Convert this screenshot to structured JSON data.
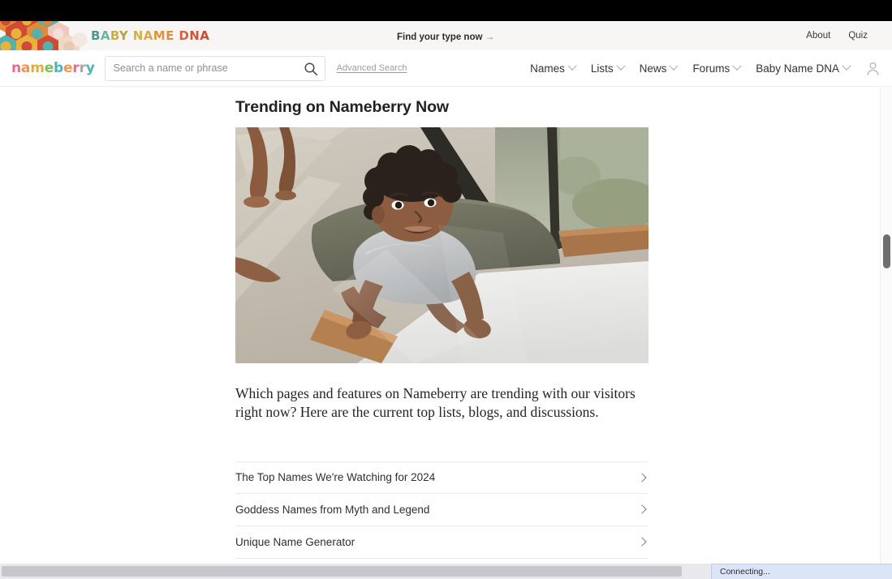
{
  "banner": {
    "title_parts": [
      {
        "text": "B",
        "color": "#4a9a8e"
      },
      {
        "text": "A",
        "color": "#6fb3a6"
      },
      {
        "text": "B",
        "color": "#cbb04a"
      },
      {
        "text": "Y",
        "color": "#b8a23f"
      },
      {
        "text": " ",
        "color": "#000000"
      },
      {
        "text": "N",
        "color": "#cdb24b"
      },
      {
        "text": "A",
        "color": "#d8a94a"
      },
      {
        "text": "M",
        "color": "#e0933f"
      },
      {
        "text": "E",
        "color": "#d98f47"
      },
      {
        "text": " ",
        "color": "#000000"
      },
      {
        "text": "D",
        "color": "#d4603f"
      },
      {
        "text": "N",
        "color": "#cf5338"
      },
      {
        "text": "A",
        "color": "#c94b32"
      }
    ],
    "cta_label": "Find your type now",
    "cta_arrow": "→",
    "links": [
      {
        "label": "About"
      },
      {
        "label": "Quiz"
      }
    ],
    "accent_arrow_color": "#e3596b",
    "background": "#f7f6f4"
  },
  "nav": {
    "brand_parts": [
      {
        "text": "n",
        "color": "#e76b8a"
      },
      {
        "text": "a",
        "color": "#f0954e"
      },
      {
        "text": "m",
        "color": "#ddb13f"
      },
      {
        "text": "e",
        "color": "#7bbf5c"
      },
      {
        "text": "b",
        "color": "#4fb3b8"
      },
      {
        "text": "e",
        "color": "#f0954e"
      },
      {
        "text": "r",
        "color": "#e76b8a"
      },
      {
        "text": "r",
        "color": "#a7a7a7"
      },
      {
        "text": "y",
        "color": "#4fb3b8"
      }
    ],
    "search": {
      "placeholder": "Search a name or phrase",
      "value": "",
      "icon": "search-icon"
    },
    "advanced_search_label": "Advanced Search",
    "items": [
      {
        "label": "Names",
        "has_dropdown": true
      },
      {
        "label": "Lists",
        "has_dropdown": true
      },
      {
        "label": "News",
        "has_dropdown": true
      },
      {
        "label": "Forums",
        "has_dropdown": true
      },
      {
        "label": "Baby Name DNA",
        "has_dropdown": true
      }
    ],
    "account_icon": "user-avatar-icon"
  },
  "article": {
    "title": "Trending on Nameberry Now",
    "hero_alt": "baby crawling on floor by window",
    "lede": "Which pages and features on Nameberry are trending with our visitors right now? Here are the current top lists, blogs, and discussions."
  },
  "trending": {
    "items": [
      {
        "label": "The Top Names We're Watching for 2024"
      },
      {
        "label": "Goddess Names from Myth and Legend"
      },
      {
        "label": "Unique Name Generator"
      }
    ],
    "chevron_icon": "chevron-right-icon"
  },
  "statusbar": {
    "text": "Connecting..."
  }
}
